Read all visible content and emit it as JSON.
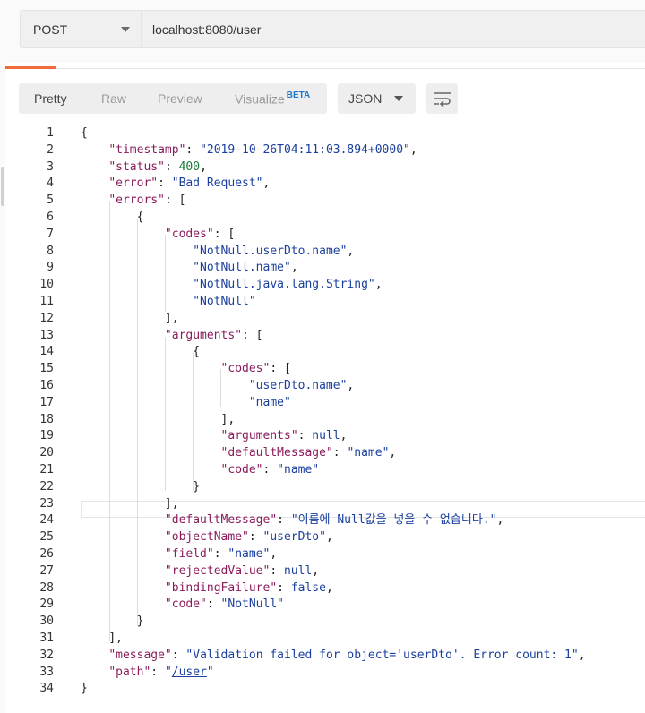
{
  "request": {
    "method": "POST",
    "url": "localhost:8080/user"
  },
  "view_tabs": [
    "Pretty",
    "Raw",
    "Preview",
    "Visualize"
  ],
  "visualize_badge": "BETA",
  "format": "JSON",
  "line_numbers": [
    "1",
    "2",
    "3",
    "4",
    "5",
    "6",
    "7",
    "8",
    "9",
    "10",
    "11",
    "12",
    "13",
    "14",
    "15",
    "16",
    "17",
    "18",
    "19",
    "20",
    "21",
    "22",
    "23",
    "24",
    "25",
    "26",
    "27",
    "28",
    "29",
    "30",
    "31",
    "32",
    "33",
    "34"
  ],
  "json": {
    "timestamp": "2019-10-26T04:11:03.894+0000",
    "status": 400,
    "error": "Bad Request",
    "codes_outer": [
      "NotNull.userDto.name",
      "NotNull.name",
      "NotNull.java.lang.String",
      "NotNull"
    ],
    "codes_inner": [
      "userDto.name",
      "name"
    ],
    "inner_defaultMessage": "name",
    "inner_code": "name",
    "defaultMessage": "이름에 Null값을 넣을 수 없습니다.",
    "objectName": "userDto",
    "field": "name",
    "rejectedValue": "null",
    "bindingFailure": "false",
    "code": "NotNull",
    "message": "Validation failed for object='userDto'. Error count: 1",
    "path": "/user"
  },
  "colors": {
    "key": "#8a1c5c",
    "string": "#1a3f9e",
    "number": "#1a7a3a",
    "accent": "#f26b3a",
    "beta": "#1f79c8"
  }
}
